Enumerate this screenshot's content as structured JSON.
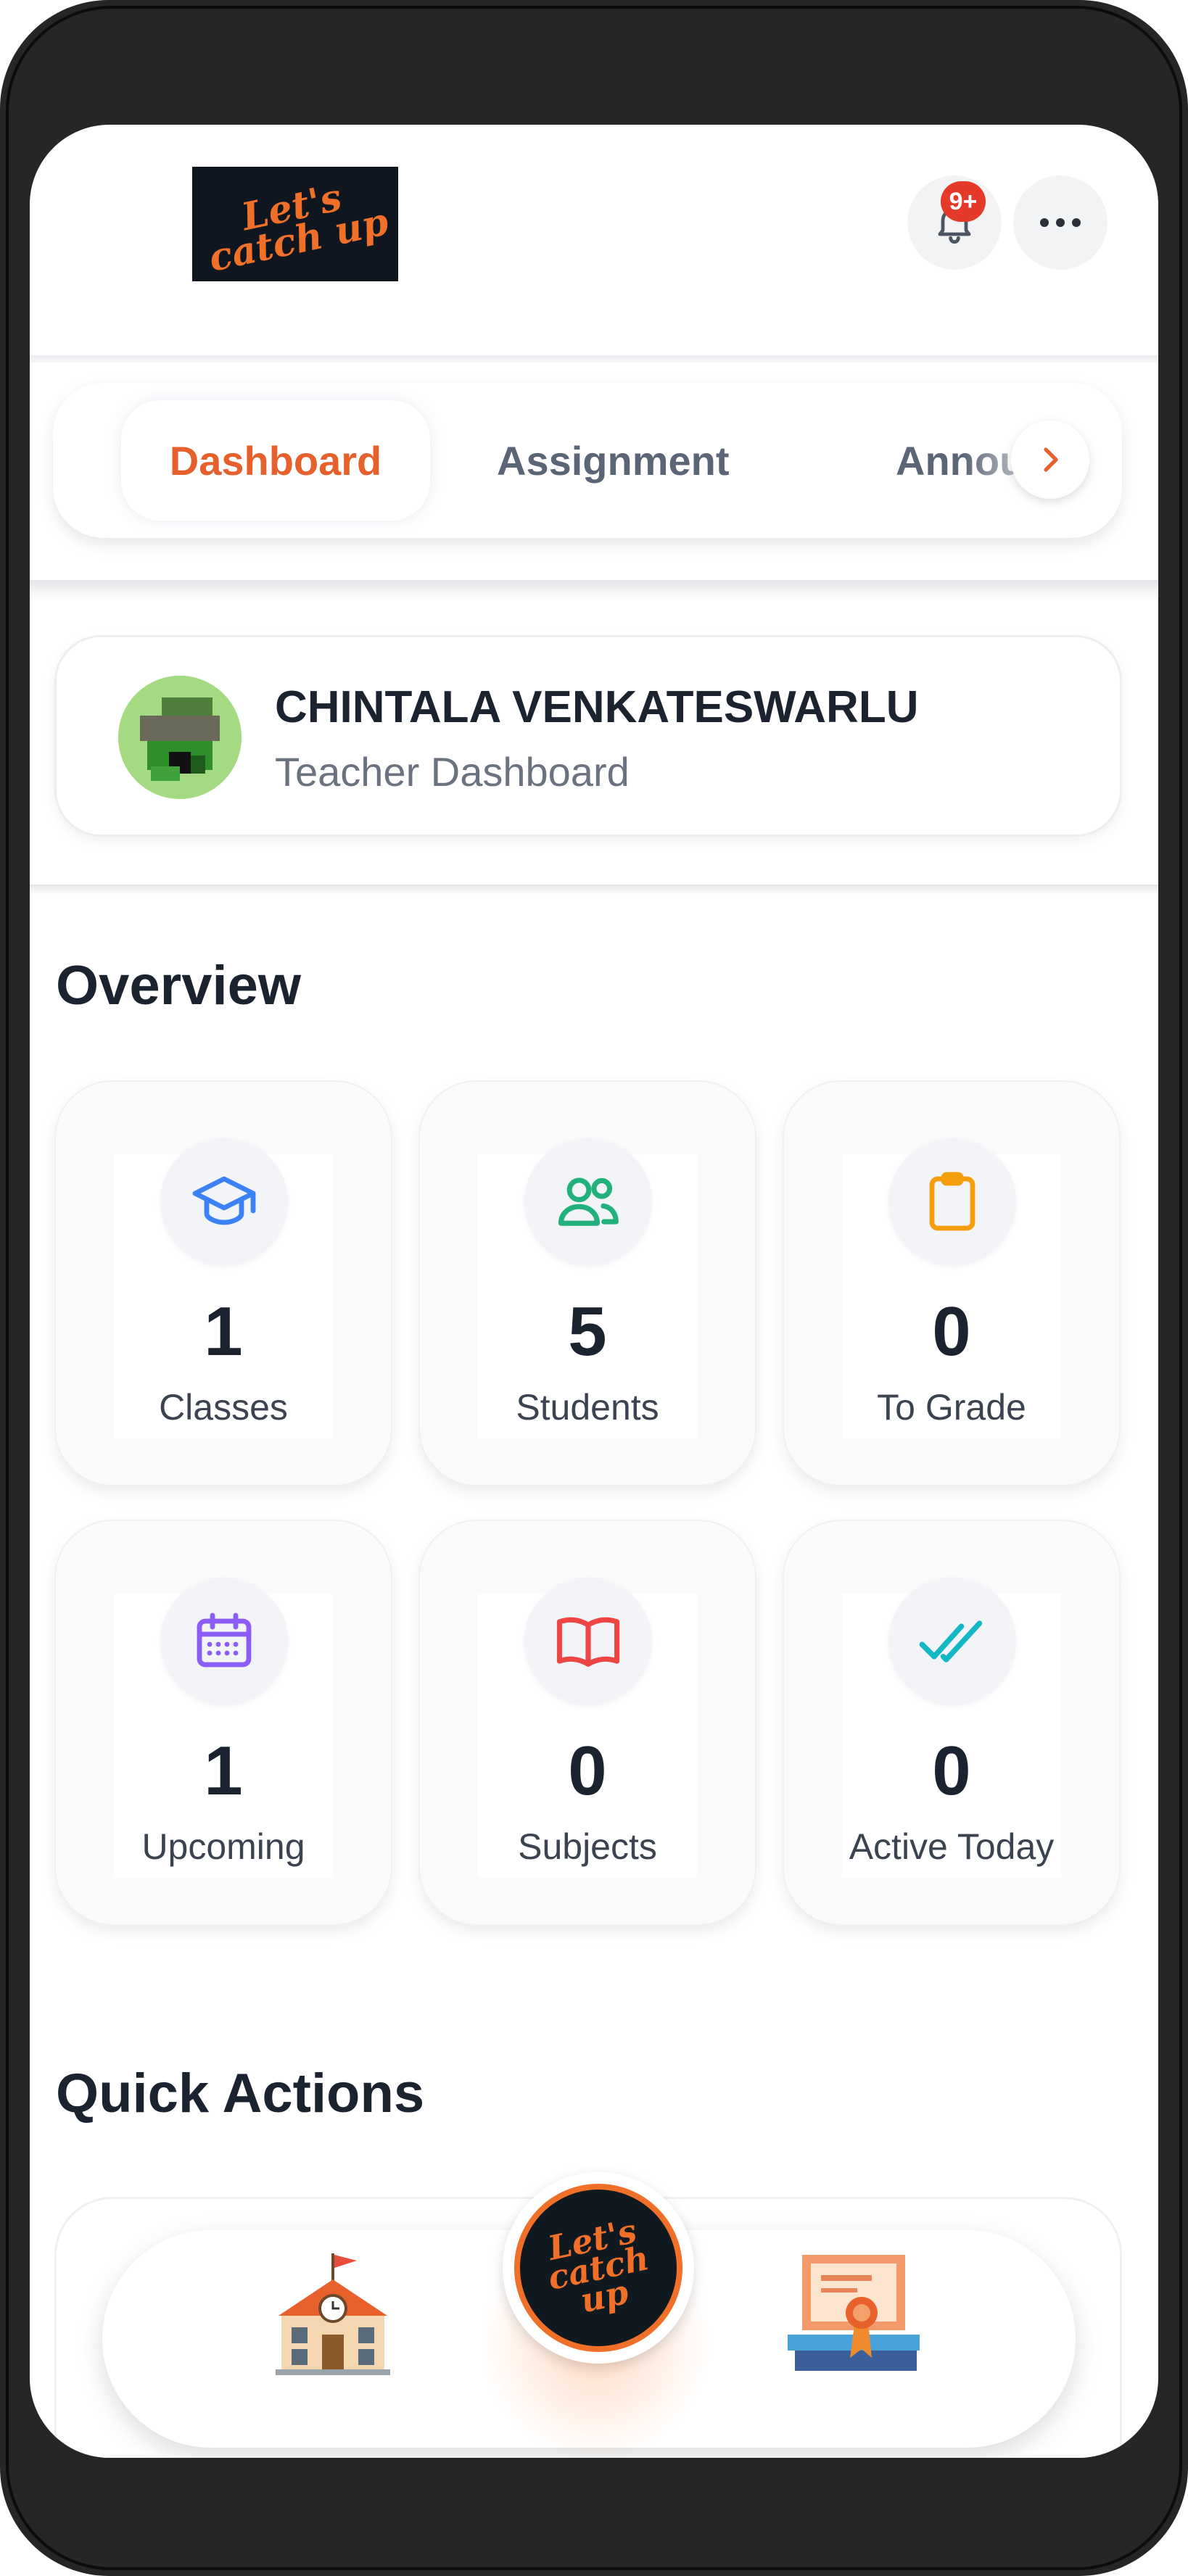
{
  "header": {
    "logo_text": "Let's catch up",
    "notification_badge": "9+",
    "icons": {
      "notifications": "bell-icon",
      "menu": "more-horizontal-icon"
    }
  },
  "tabs": {
    "items": [
      {
        "label": "Dashboard",
        "active": true
      },
      {
        "label": "Assignment",
        "active": false
      },
      {
        "label": "Announcements",
        "active": false
      }
    ],
    "next_icon": "chevron-right-icon"
  },
  "profile": {
    "name": "CHINTALA VENKATESWARLU",
    "role": "Teacher Dashboard"
  },
  "overview": {
    "title": "Overview",
    "stats": [
      {
        "value": "1",
        "label": "Classes",
        "icon": "graduation-cap-icon",
        "color": "#3b82f6"
      },
      {
        "value": "5",
        "label": "Students",
        "icon": "users-icon",
        "color": "#22b07d"
      },
      {
        "value": "0",
        "label": "To Grade",
        "icon": "clipboard-icon",
        "color": "#f59e0b"
      },
      {
        "value": "1",
        "label": "Upcoming",
        "icon": "calendar-icon",
        "color": "#8b5cf6"
      },
      {
        "value": "0",
        "label": "Subjects",
        "icon": "book-open-icon",
        "color": "#ef4444"
      },
      {
        "value": "0",
        "label": "Active Today",
        "icon": "double-check-icon",
        "color": "#14b8c4"
      }
    ]
  },
  "quick_actions": {
    "title": "Quick Actions"
  },
  "bottom_nav": {
    "items": [
      {
        "icon": "school-building-icon"
      },
      {
        "icon": "home-logo-icon",
        "text": "Let's catch up"
      },
      {
        "icon": "certificate-icon"
      }
    ]
  },
  "colors": {
    "accent": "#e5602d",
    "text_primary": "#1b2330",
    "text_secondary": "#6b7280"
  }
}
